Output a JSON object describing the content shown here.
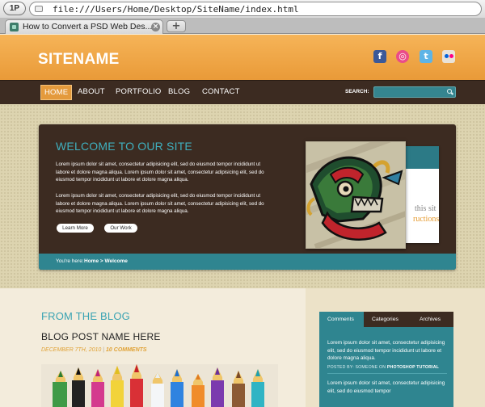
{
  "browser": {
    "badge": "1P",
    "url": "file:///Users/Home/Desktop/SiteName/index.html",
    "tab_title": "How to Convert a PSD Web Des...",
    "new_tab": "+",
    "tab_close": "×"
  },
  "site": {
    "logo": "SITENAME",
    "social": [
      {
        "name": "facebook-icon",
        "glyph": "f"
      },
      {
        "name": "dribbble-icon",
        "glyph": "◎"
      },
      {
        "name": "twitter-icon",
        "glyph": "t"
      },
      {
        "name": "flickr-icon",
        "glyph": ""
      }
    ],
    "nav": [
      "HOME",
      "ABOUT",
      "PORTFOLIO",
      "BLOG",
      "CONTACT"
    ],
    "search_label": "SEARCH:",
    "welcome": {
      "title": "WELCOME TO OUR SITE",
      "para1": "Lorem ipsum dolor sit amet, consectetur adipisicing elit, sed do eiusmod tempor incididunt ut labore et dolore magna aliqua. Lorem ipsum dolor sit amet, consectetur adipisicing elit, sed do eiusmod tempor incididunt ut labore et dolore magna aliqua.",
      "para2": "Lorem ipsum dolor sit amet, consectetur adipisicing elit, sed do eiusmod tempor incididunt ut labore et dolore magna aliqua. Lorem ipsum dolor sit amet, consectetur adipisicing elit, sed do eiusmod tempor incididunt ut labore et dolore magna aliqua.",
      "btn_learn": "Learn More",
      "btn_work": "Our Work",
      "card_text1": "this sit",
      "card_text2": "ructions"
    },
    "breadcrumb": {
      "label": "You're here:",
      "path": "Home > Welcome"
    },
    "blog": {
      "heading": "FROM THE BLOG",
      "post_title": "BLOG POST NAME HERE",
      "post_date": "DECEMBER 7TH, 2010",
      "post_sep": " | ",
      "post_comments": "10 COMMENTS"
    },
    "sidebar": {
      "tabs": [
        "Comments",
        "Categories",
        "Archives"
      ],
      "comment1": "Lorem ipsum dolor sit amet, consectetur adipisicing elit, sed do eiusmod tempor incididunt ut labore et dolore magna aliqua.",
      "meta_prefix": "POSTED BY: SOMEONE ON",
      "meta_link": "PHOTOSHOP TUTORIAL",
      "comment2": "Lorem ipsum dolor sit amet, consectetur adipisicing elit, sed do eiusmod tempor"
    }
  },
  "colors": {
    "header_orange": "#f0a84a",
    "nav_brown": "#3c2b21",
    "accent_teal": "#2f8590",
    "heading_teal": "#3aa3b3",
    "date_orange": "#e0a236"
  }
}
